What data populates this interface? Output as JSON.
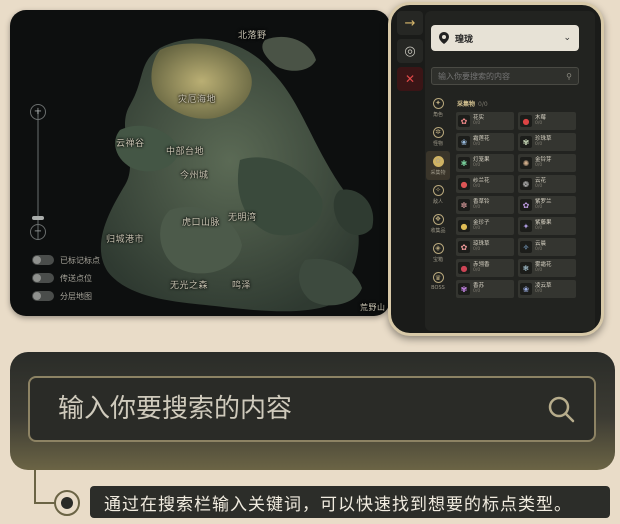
{
  "map": {
    "places": [
      "北落野",
      "灾厄海地",
      "云禅谷",
      "中部台地",
      "今州城",
      "虎口山脉",
      "无明湾",
      "归城港市",
      "无光之森",
      "鸣泽",
      "荒野山"
    ],
    "toggles": [
      "已标记标点",
      "传送点位",
      "分层地图"
    ],
    "zoom_in": "+",
    "zoom_out": "−"
  },
  "panel": {
    "rail": {
      "arrow_icon": "→",
      "hide_icon": "◎",
      "close_icon": "✕"
    },
    "region": "瑝珑",
    "search_placeholder": "输入你要搜索的内容",
    "categories": [
      {
        "label": "角色",
        "icon": "✦"
      },
      {
        "label": "怪物",
        "icon": "✲"
      },
      {
        "label": "采集物",
        "icon": "✿"
      },
      {
        "label": "敌人",
        "icon": "✧"
      },
      {
        "label": "收集品",
        "icon": "❖"
      },
      {
        "label": "宝箱",
        "icon": "◈"
      },
      {
        "label": "BOSS",
        "icon": "♛"
      }
    ],
    "items_header": "采集物",
    "items_header_count": "0/0",
    "items": [
      {
        "name": "花实",
        "count": "0/0",
        "icon": "✿",
        "color": "#e88"
      },
      {
        "name": "木莓",
        "count": "0/0",
        "icon": "●",
        "color": "#d44"
      },
      {
        "name": "霜莲花",
        "count": "0/0",
        "icon": "❀",
        "color": "#9bd"
      },
      {
        "name": "珍珠草",
        "count": "0/0",
        "icon": "✾",
        "color": "#cdb"
      },
      {
        "name": "灯笼果",
        "count": "0/0",
        "icon": "✱",
        "color": "#7c9"
      },
      {
        "name": "金铃芽",
        "count": "0/0",
        "icon": "✺",
        "color": "#ca8"
      },
      {
        "name": "纱兰花",
        "count": "0/0",
        "icon": "●",
        "color": "#d55"
      },
      {
        "name": "云花",
        "count": "0/0",
        "icon": "❁",
        "color": "#ccc"
      },
      {
        "name": "香草铃",
        "count": "0/0",
        "icon": "✽",
        "color": "#b88"
      },
      {
        "name": "紫罗兰",
        "count": "0/0",
        "icon": "✿",
        "color": "#b9d"
      },
      {
        "name": "金珍子",
        "count": "0/0",
        "icon": "●",
        "color": "#db5"
      },
      {
        "name": "紫藤果",
        "count": "0/0",
        "icon": "✦",
        "color": "#a9d"
      },
      {
        "name": "琼珠草",
        "count": "0/0",
        "icon": "✿",
        "color": "#e99"
      },
      {
        "name": "云晨",
        "count": "0/0",
        "icon": "✧",
        "color": "#9cf"
      },
      {
        "name": "赤翎香",
        "count": "0/0",
        "icon": "●",
        "color": "#c45"
      },
      {
        "name": "雾霜花",
        "count": "0/0",
        "icon": "❄",
        "color": "#bde"
      },
      {
        "name": "香苏",
        "count": "0/0",
        "icon": "✾",
        "color": "#c8e"
      },
      {
        "name": "凌云草",
        "count": "0/0",
        "icon": "❀",
        "color": "#9ad"
      }
    ]
  },
  "big_search": {
    "placeholder": "输入你要搜索的内容"
  },
  "caption": "通过在搜索栏输入关键词，可以快速找到想要的标点类型。"
}
